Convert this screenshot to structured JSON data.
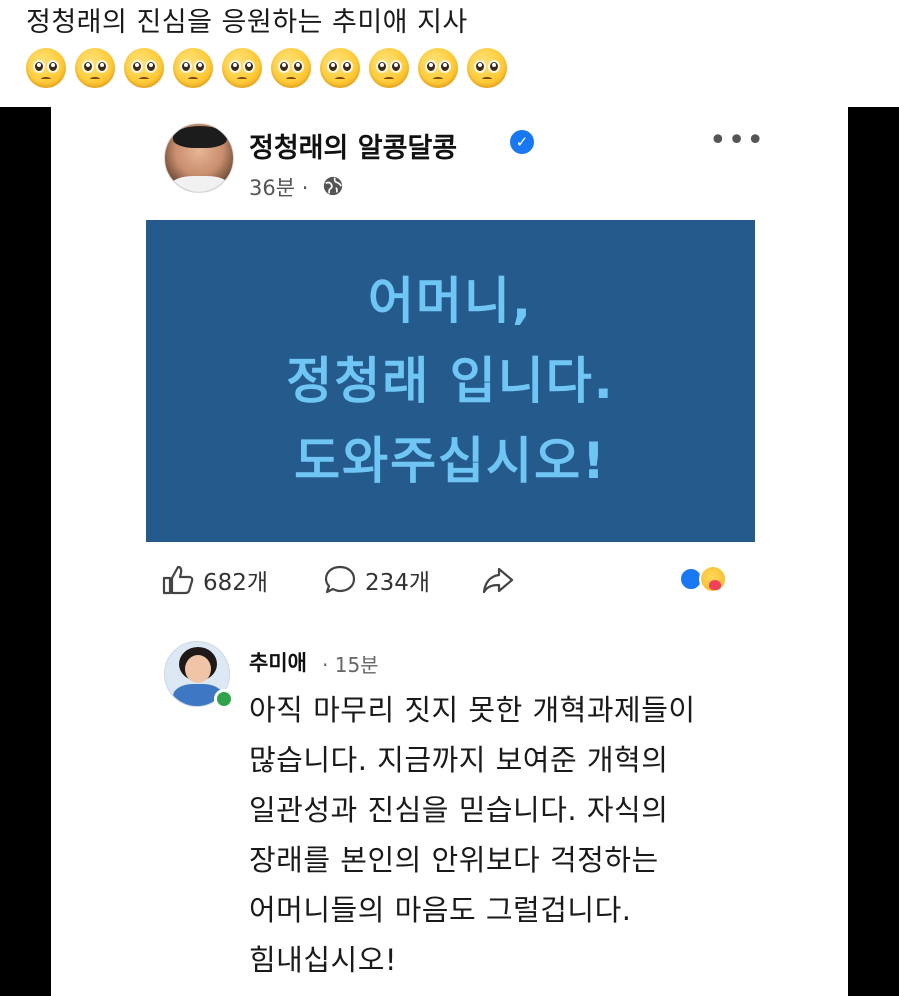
{
  "caption": {
    "text": "정청래의 진심을 응원하는 추미애 지사",
    "emoji_name": "pleading-face-emoji",
    "emoji_count": 10
  },
  "post": {
    "page_name": "정청래의 알콩달콩",
    "verified_mark": "✓",
    "time": "36분 ·",
    "banner": {
      "line1": "어머니,",
      "line2": "정청래 입니다.",
      "line3": "도와주십시오!",
      "background": "#245a8c",
      "text_color": "#6fc6f4"
    },
    "likes": "682개",
    "comments": "234개"
  },
  "comment": {
    "author": "추미애",
    "time": "· 15분",
    "lines": [
      "아직 마무리 짓지 못한 개혁과제들이",
      "많습니다. 지금까지 보여준 개혁의",
      "일관성과 진심을 믿습니다. 자식의",
      "장래를 본인의 안위보다 걱정하는",
      "어머니들의 마음도 그럴겁니다.",
      "힘내십시오!"
    ]
  }
}
